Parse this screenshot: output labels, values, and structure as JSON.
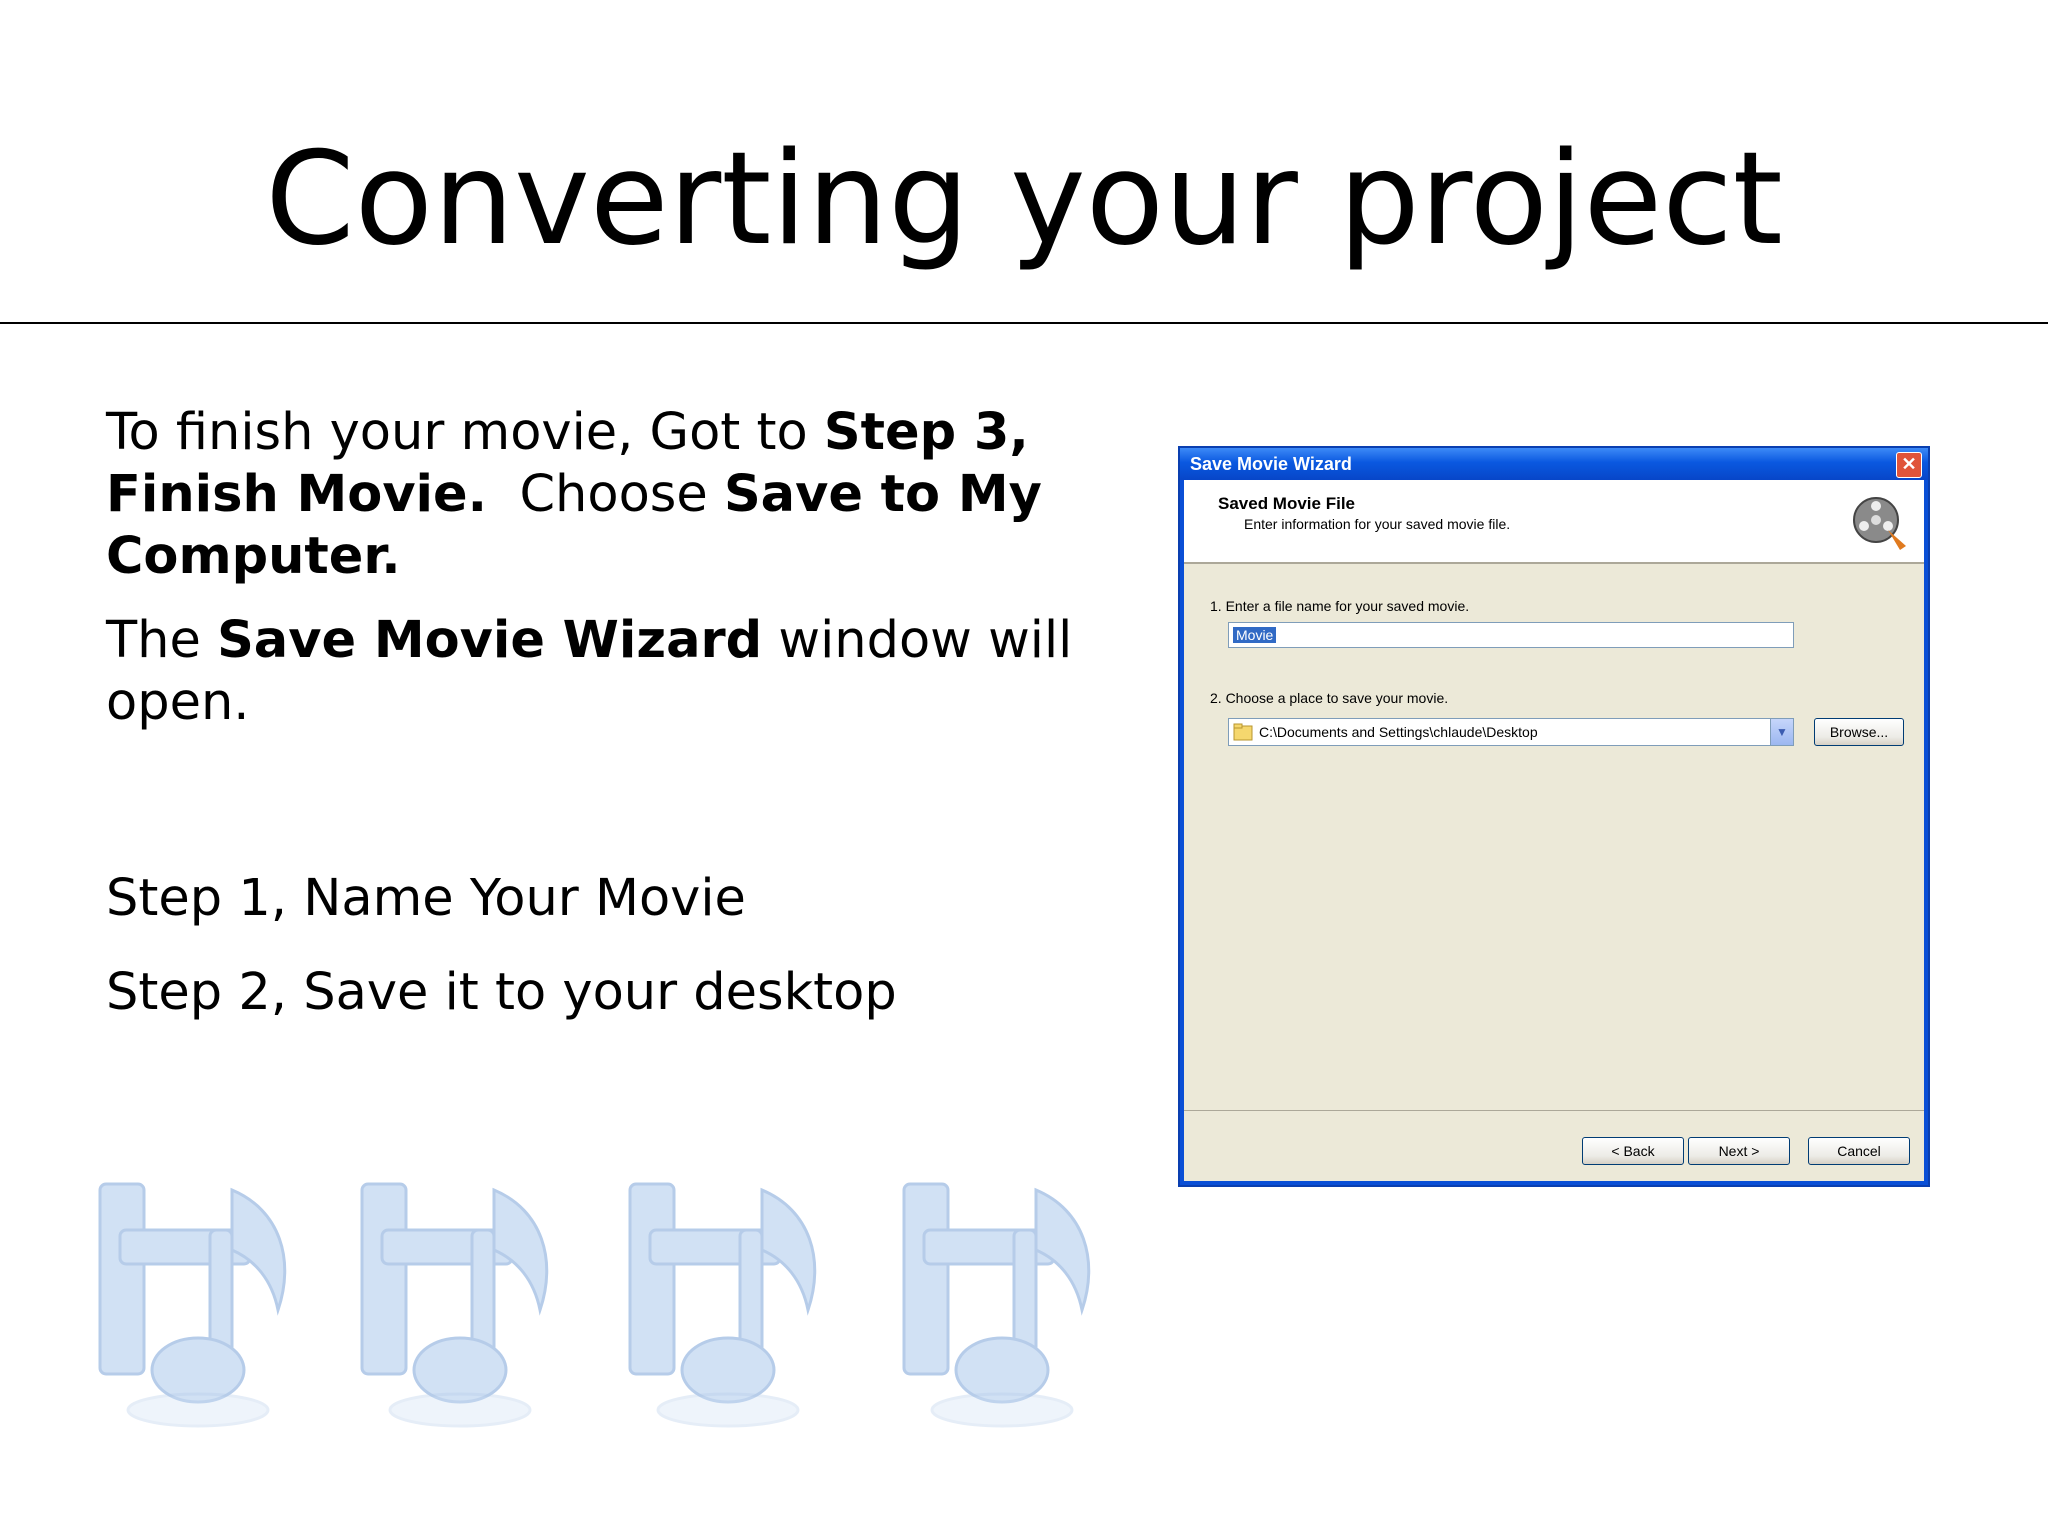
{
  "slide": {
    "title": "Converting your project",
    "para1": {
      "t1": "To finish your movie, Got to ",
      "b1": "Step 3, Finish Movie.",
      "t2": "  Choose ",
      "b2": "Save to My Computer."
    },
    "para2": {
      "t1": "The ",
      "b1": "Save Movie Wizard",
      "t2": " window will open."
    },
    "step1": "Step 1, Name Your Movie",
    "step2": "Step 2, Save it to your desktop"
  },
  "wizard": {
    "window_title": "Save Movie Wizard",
    "close_glyph": "✕",
    "header_title": "Saved Movie File",
    "header_subtitle": "Enter information for your saved movie file.",
    "field1_label": "1. Enter a file name for your saved movie.",
    "field1_value": "Movie",
    "field2_label": "2. Choose a place to save your movie.",
    "field2_value": "C:\\Documents and Settings\\chlaude\\Desktop",
    "browse_label": "Browse...",
    "back_label": "< Back",
    "next_label": "Next >",
    "cancel_label": "Cancel",
    "dropdown_glyph": "▼"
  },
  "colors": {
    "titlebar": "#0a58e0",
    "dialog_face": "#ece9d8",
    "selection": "#316ac5",
    "decor_note": "#c9dcf3"
  },
  "icons": {
    "header_icon": "film-reel-icon",
    "folder_icon": "folder-icon",
    "decor": "film-music-note-icon"
  }
}
